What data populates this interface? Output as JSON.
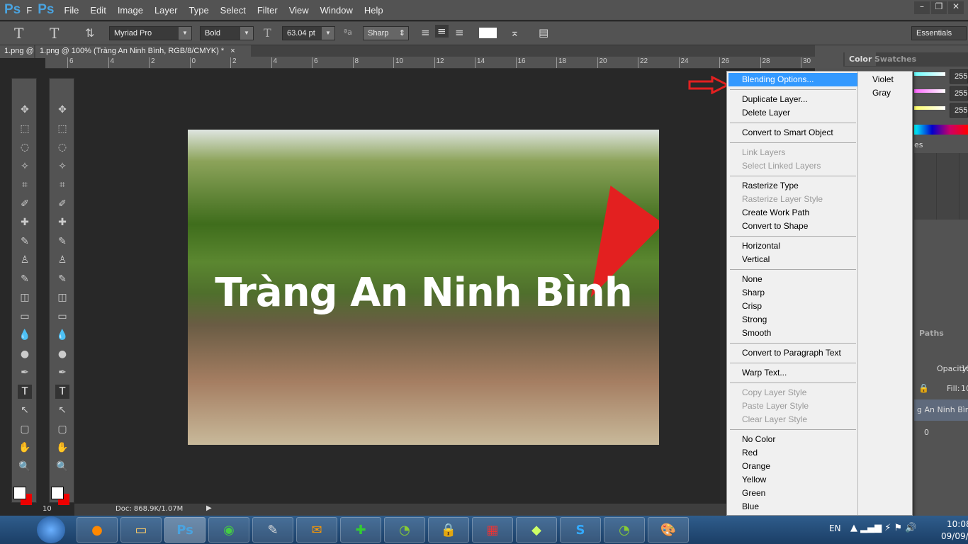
{
  "app": {
    "logo": "Ps",
    "title_fragment": "F"
  },
  "menubar": [
    "File",
    "Edit",
    "Image",
    "Layer",
    "Type",
    "Select",
    "Filter",
    "View",
    "Window",
    "Help"
  ],
  "options": {
    "font_family": "Myriad Pro",
    "font_style": "Bold",
    "font_size": "63.04 pt",
    "antialias": "Sharp",
    "workspace": "Essentials"
  },
  "tabs": [
    {
      "label": "1.png @"
    },
    {
      "label": "1.png @ 100% (Tràng An Ninh Bình, RGB/8/CMYK) *",
      "close": "×"
    }
  ],
  "ruler_ticks": [
    "6",
    "4",
    "2",
    "0",
    "2",
    "4",
    "6",
    "8",
    "10",
    "12",
    "14",
    "16",
    "18",
    "20",
    "22",
    "24",
    "26",
    "28",
    "30"
  ],
  "canvas": {
    "text_layer": "Tràng An Ninh Bình"
  },
  "status": {
    "zoom": "10",
    "doc": "Doc: 868.9K/1.07M"
  },
  "panels": {
    "color_tab": "Color",
    "swatches_tab": "Swatches",
    "values": [
      "255",
      "255",
      "255"
    ],
    "styles_tab_fragment": "es",
    "paths_tab": "Paths",
    "opacity_label": "Opacity:",
    "opacity_fragment": "10",
    "fill_label": "Fill:",
    "fill_fragment": "10",
    "layer_name_fragment": "g An Ninh Bình",
    "layer2_fragment": "0"
  },
  "context_menu": {
    "items": [
      {
        "label": "Blending Options...",
        "state": "highlighted"
      },
      {
        "sep": true
      },
      {
        "label": "Duplicate Layer..."
      },
      {
        "label": "Delete Layer"
      },
      {
        "sep": true
      },
      {
        "label": "Convert to Smart Object"
      },
      {
        "sep": true
      },
      {
        "label": "Link Layers",
        "state": "disabled"
      },
      {
        "label": "Select Linked Layers",
        "state": "disabled"
      },
      {
        "sep": true
      },
      {
        "label": "Rasterize Type"
      },
      {
        "label": "Rasterize Layer Style",
        "state": "disabled"
      },
      {
        "label": "Create Work Path"
      },
      {
        "label": "Convert to Shape"
      },
      {
        "sep": true
      },
      {
        "label": "Horizontal"
      },
      {
        "label": "Vertical"
      },
      {
        "sep": true
      },
      {
        "label": "None"
      },
      {
        "label": "Sharp"
      },
      {
        "label": "Crisp"
      },
      {
        "label": "Strong"
      },
      {
        "label": "Smooth"
      },
      {
        "sep": true
      },
      {
        "label": "Convert to Paragraph Text"
      },
      {
        "sep": true
      },
      {
        "label": "Warp Text..."
      },
      {
        "sep": true
      },
      {
        "label": "Copy Layer Style",
        "state": "disabled"
      },
      {
        "label": "Paste Layer Style",
        "state": "disabled"
      },
      {
        "label": "Clear Layer Style",
        "state": "disabled"
      },
      {
        "sep": true
      },
      {
        "label": "No Color"
      },
      {
        "label": "Red"
      },
      {
        "label": "Orange"
      },
      {
        "label": "Yellow"
      },
      {
        "label": "Green"
      },
      {
        "label": "Blue"
      }
    ],
    "submenu": [
      "Violet",
      "Gray"
    ]
  },
  "taskbar": {
    "lang": "EN",
    "time": "10:08",
    "date": "09/09/2"
  },
  "colors": {
    "highlight": "#3399ff",
    "arrow": "#e32020"
  }
}
